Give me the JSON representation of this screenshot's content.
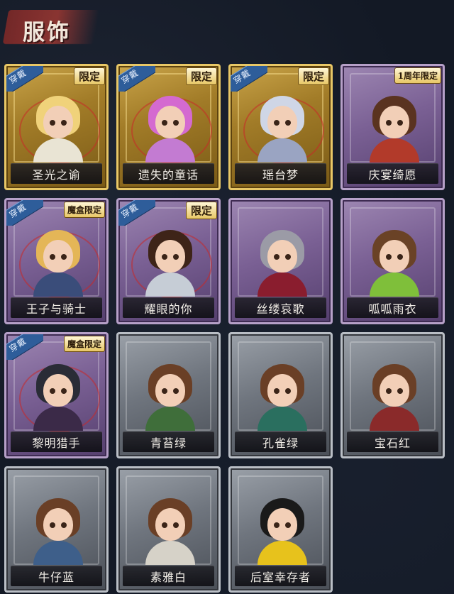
{
  "header": {
    "title": "服饰"
  },
  "wear_label": "穿戴",
  "cards": [
    {
      "name": "圣光之谕",
      "tier": "gold",
      "tag": "限定",
      "worn": true,
      "hair": "#f0d27a",
      "outfit": "#e9e4d4"
    },
    {
      "name": "遗失的童话",
      "tier": "gold",
      "tag": "限定",
      "worn": true,
      "hair": "#d46ad0",
      "outfit": "#c37bd2"
    },
    {
      "name": "瑶台梦",
      "tier": "gold",
      "tag": "限定",
      "worn": true,
      "hair": "#cfd6e6",
      "outfit": "#9aa4c2"
    },
    {
      "name": "庆宴绮愿",
      "tier": "purple",
      "tag": "1周年限定",
      "worn": false,
      "hair": "#5a3320",
      "outfit": "#b23a2a"
    },
    {
      "name": "王子与骑士",
      "tier": "purple",
      "tag": "魔盒限定",
      "worn": true,
      "hair": "#e4b657",
      "outfit": "#3a4d7a"
    },
    {
      "name": "耀眼的你",
      "tier": "purple",
      "tag": "限定",
      "worn": true,
      "hair": "#3e2418",
      "outfit": "#c6cdd6"
    },
    {
      "name": "丝缕哀歌",
      "tier": "purple",
      "tag": "",
      "worn": false,
      "hair": "#9b9ba6",
      "outfit": "#8a1d2e"
    },
    {
      "name": "呱呱雨衣",
      "tier": "purple",
      "tag": "",
      "worn": false,
      "hair": "#6a4226",
      "outfit": "#7fbf3a"
    },
    {
      "name": "黎明猎手",
      "tier": "purple",
      "tag": "魔盒限定",
      "worn": true,
      "hair": "#2a2c36",
      "outfit": "#3b2a48"
    },
    {
      "name": "青苔绿",
      "tier": "gray",
      "tag": "",
      "worn": false,
      "hair": "#6a3f26",
      "outfit": "#3f6e3a"
    },
    {
      "name": "孔雀绿",
      "tier": "gray",
      "tag": "",
      "worn": false,
      "hair": "#6a3f26",
      "outfit": "#2a6f5f"
    },
    {
      "name": "宝石红",
      "tier": "gray",
      "tag": "",
      "worn": false,
      "hair": "#6a3f26",
      "outfit": "#8a2a2a"
    },
    {
      "name": "牛仔蓝",
      "tier": "gray",
      "tag": "",
      "worn": false,
      "hair": "#6a3f26",
      "outfit": "#3e5f8a"
    },
    {
      "name": "素雅白",
      "tier": "gray",
      "tag": "",
      "worn": false,
      "hair": "#6a3f26",
      "outfit": "#d6d2c8"
    },
    {
      "name": "后室幸存者",
      "tier": "gray",
      "tag": "",
      "worn": false,
      "hair": "#1a1a1a",
      "outfit": "#e7c21c"
    }
  ]
}
